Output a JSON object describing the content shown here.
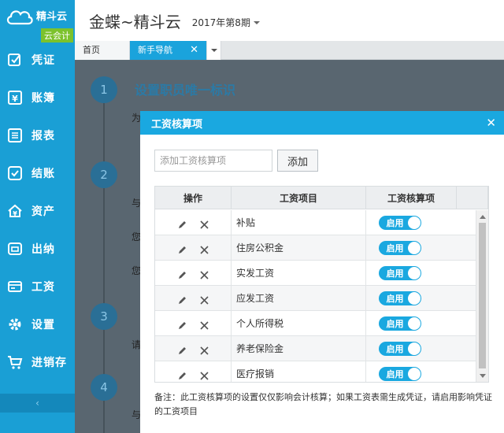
{
  "brand": {
    "name": "精斗云",
    "badge": "云会计"
  },
  "sidebar": {
    "items": [
      {
        "label": "凭证",
        "icon": "voucher-icon"
      },
      {
        "label": "账簿",
        "icon": "ledger-icon"
      },
      {
        "label": "报表",
        "icon": "report-icon"
      },
      {
        "label": "结账",
        "icon": "checkout-icon"
      },
      {
        "label": "资产",
        "icon": "asset-icon"
      },
      {
        "label": "出纳",
        "icon": "cashier-icon"
      },
      {
        "label": "工资",
        "icon": "salary-icon"
      },
      {
        "label": "设置",
        "icon": "gear-icon"
      },
      {
        "label": "进销存",
        "icon": "cart-icon"
      }
    ],
    "collapse_glyph": "‹"
  },
  "header": {
    "title": "金蝶~精斗云",
    "period": "2017年第8期"
  },
  "tabs": [
    {
      "label": "首页"
    },
    {
      "label": "新手导航",
      "active": true
    }
  ],
  "background": {
    "steps": [
      "1",
      "2",
      "3",
      "4"
    ],
    "step1_title": "设置职员唯一标识",
    "fragments": [
      "为",
      "与",
      "您",
      "您",
      "请",
      "与"
    ]
  },
  "dialog": {
    "title": "工资核算项",
    "input_placeholder": "添加工资核算项",
    "add_label": "添加",
    "columns": [
      "操作",
      "工资项目",
      "工资核算项"
    ],
    "rows": [
      {
        "item": "补贴",
        "status": "启用"
      },
      {
        "item": "住房公积金",
        "status": "启用"
      },
      {
        "item": "实发工资",
        "status": "启用"
      },
      {
        "item": "应发工资",
        "status": "启用"
      },
      {
        "item": "个人所得税",
        "status": "启用"
      },
      {
        "item": "养老保险金",
        "status": "启用"
      },
      {
        "item": "医疗报销",
        "status": "启用"
      }
    ],
    "note": "备注：此工资核算项的设置仅仅影响会计核算；如果工资表需生成凭证，请启用影响凭证的工资项目"
  },
  "colors": {
    "accent": "#1aa8e0",
    "sidebar": "#1a9fd5",
    "badge": "#7cc22c"
  }
}
